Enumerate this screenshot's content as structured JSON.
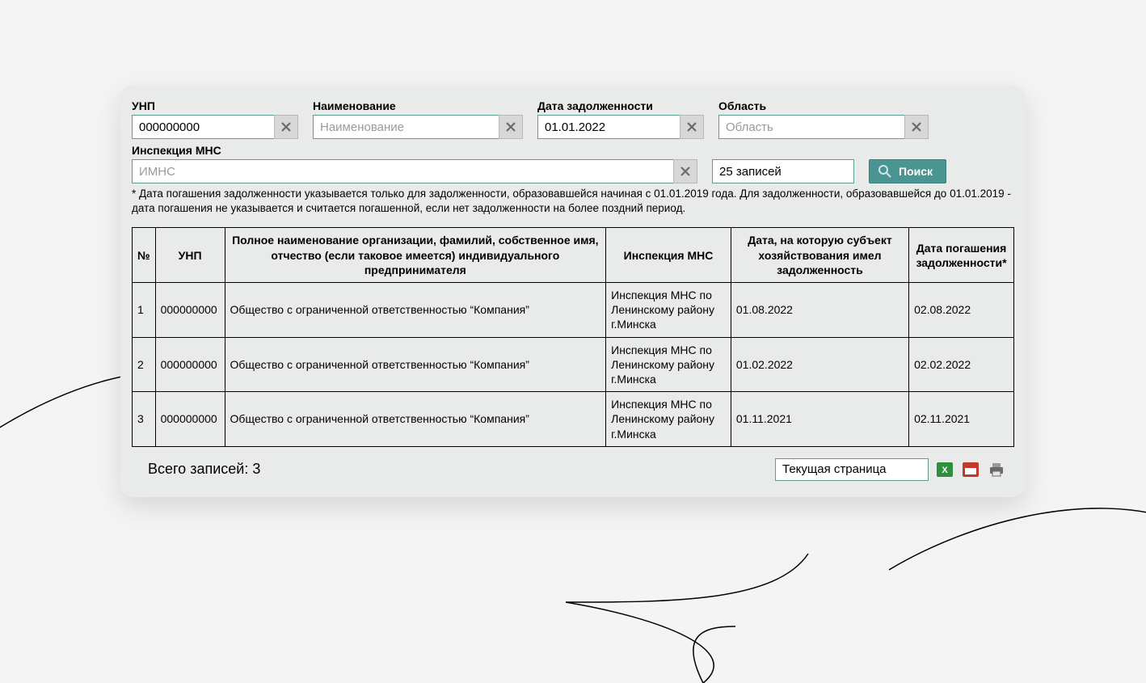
{
  "filters": {
    "unp": {
      "label": "УНП",
      "value": "000000000",
      "placeholder": ""
    },
    "name": {
      "label": "Наименование",
      "value": "",
      "placeholder": "Наименование"
    },
    "debt_date": {
      "label": "Дата задолженности",
      "value": "01.01.2022",
      "placeholder": ""
    },
    "region": {
      "label": "Область",
      "value": "",
      "placeholder": "Область"
    },
    "imns": {
      "label": "Инспекция МНС",
      "value": "",
      "placeholder": "ИМНС"
    },
    "records": "25 записей",
    "search_label": "Поиск"
  },
  "footnote": "* Дата погашения задолженности указывается только для задолженности, образовавшейся начиная с 01.01.2019 года. Для задолженности, образовавшейся до 01.01.2019 - дата погашения не указывается и считается погашенной, если нет задолженности на более поздний период.",
  "table": {
    "headers": {
      "n": "№",
      "unp": "УНП",
      "name": "Полное наименование организации, фамилий, собственное имя, отчество (если таковое имеется) индивидуального предпринимателя",
      "insp": "Инспекция МНС",
      "debt": "Дата, на которую субъект хозяйствования имел задолженность",
      "repay": "Дата погашения задолженности*"
    },
    "rows": [
      {
        "n": "1",
        "unp": "000000000",
        "name": "Общество с ограниченной ответственностью “Компания”",
        "insp": "Инспекция МНС по Ленинскому району г.Минска",
        "debt": "01.08.2022",
        "repay": "02.08.2022"
      },
      {
        "n": "2",
        "unp": "000000000",
        "name": "Общество с ограниченной ответственностью “Компания”",
        "insp": "Инспекция МНС по Ленинскому району г.Минска",
        "debt": "01.02.2022",
        "repay": "02.02.2022"
      },
      {
        "n": "3",
        "unp": "000000000",
        "name": "Общество с ограниченной ответственностью “Компания”",
        "insp": "Инспекция МНС по Ленинскому району г.Минска",
        "debt": "01.11.2021",
        "repay": "02.11.2021"
      }
    ]
  },
  "total_label": "Всего записей: 3",
  "page_select": "Текущая страница"
}
